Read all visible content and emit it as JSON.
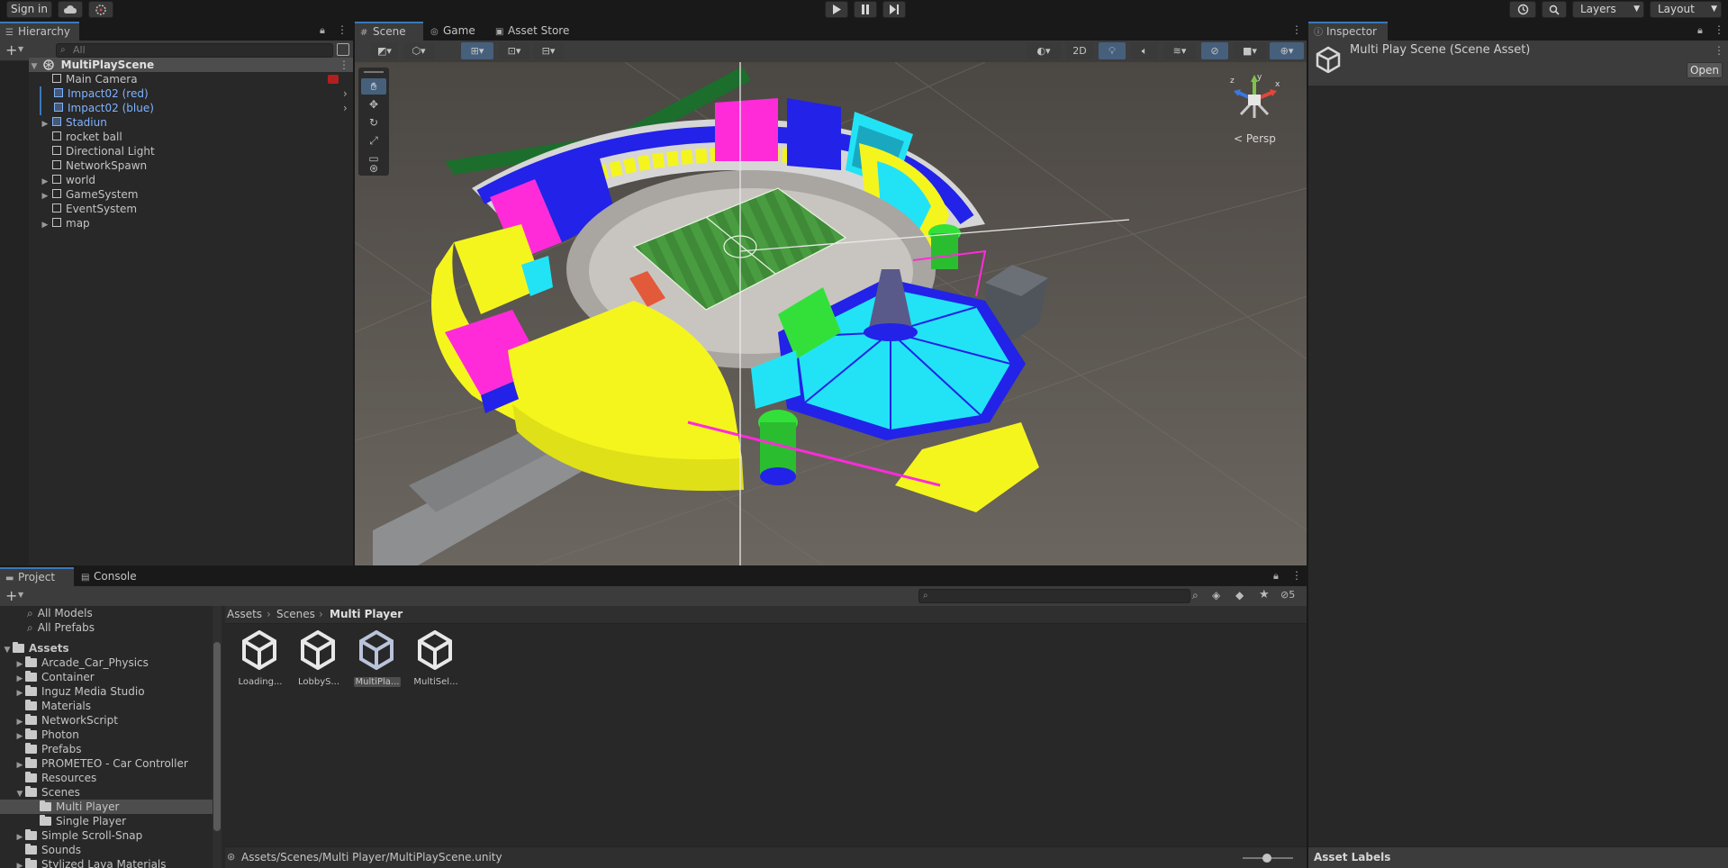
{
  "toolbar": {
    "sign_in": "Sign in",
    "layers": "Layers",
    "layout": "Layout"
  },
  "hierarchy": {
    "tab": "Hierarchy",
    "search_placeholder": "All",
    "scene": "MultiPlayScene",
    "items": [
      {
        "label": "Main Camera"
      },
      {
        "label": "Impact02 (red)"
      },
      {
        "label": "Impact02 (blue)"
      },
      {
        "label": "Stadiun"
      },
      {
        "label": "rocket ball"
      },
      {
        "label": "Directional Light"
      },
      {
        "label": "NetworkSpawn"
      },
      {
        "label": "world"
      },
      {
        "label": "GameSystem"
      },
      {
        "label": "EventSystem"
      },
      {
        "label": "map"
      }
    ]
  },
  "scene": {
    "tabs": [
      "Scene",
      "Game",
      "Asset Store"
    ],
    "toggle_2d": "2D",
    "persp": "Persp",
    "gizmo_axes": [
      "x",
      "y",
      "z"
    ]
  },
  "inspector": {
    "tab": "Inspector",
    "title": "Multi Play Scene (Scene Asset)",
    "open": "Open",
    "asset_labels": "Asset Labels"
  },
  "project": {
    "tabs": [
      "Project",
      "Console"
    ],
    "favorites": [
      "All Models",
      "All Prefabs"
    ],
    "root": "Assets",
    "folders": [
      "Arcade_Car_Physics",
      "Container",
      "Inguz Media Studio",
      "Materials",
      "NetworkScript",
      "Photon",
      "Prefabs",
      "PROMETEO - Car Controller",
      "Resources",
      "Scenes"
    ],
    "scene_children": [
      "Multi Player",
      "Single Player"
    ],
    "folders_after": [
      "Simple Scroll-Snap",
      "Sounds",
      "Stylized Lava Materials"
    ],
    "breadcrumb": [
      "Assets",
      "Scenes",
      "Multi Player"
    ],
    "hidden_count": "5",
    "assets": [
      "Loading...",
      "LobbyS...",
      "MultiPla...",
      "MultiSel..."
    ],
    "status_path": "Assets/Scenes/Multi Player/MultiPlayScene.unity"
  },
  "colors": {
    "accent": "#3a79bb",
    "selection": "#2c5d87",
    "prefab_blue": "#7eb2ff",
    "panel_bg": "#282828",
    "stadium_yellow": "#f5f51e",
    "stadium_cyan": "#22e3f5",
    "stadium_magenta": "#ff2bd9",
    "stadium_blue": "#2222e8"
  }
}
